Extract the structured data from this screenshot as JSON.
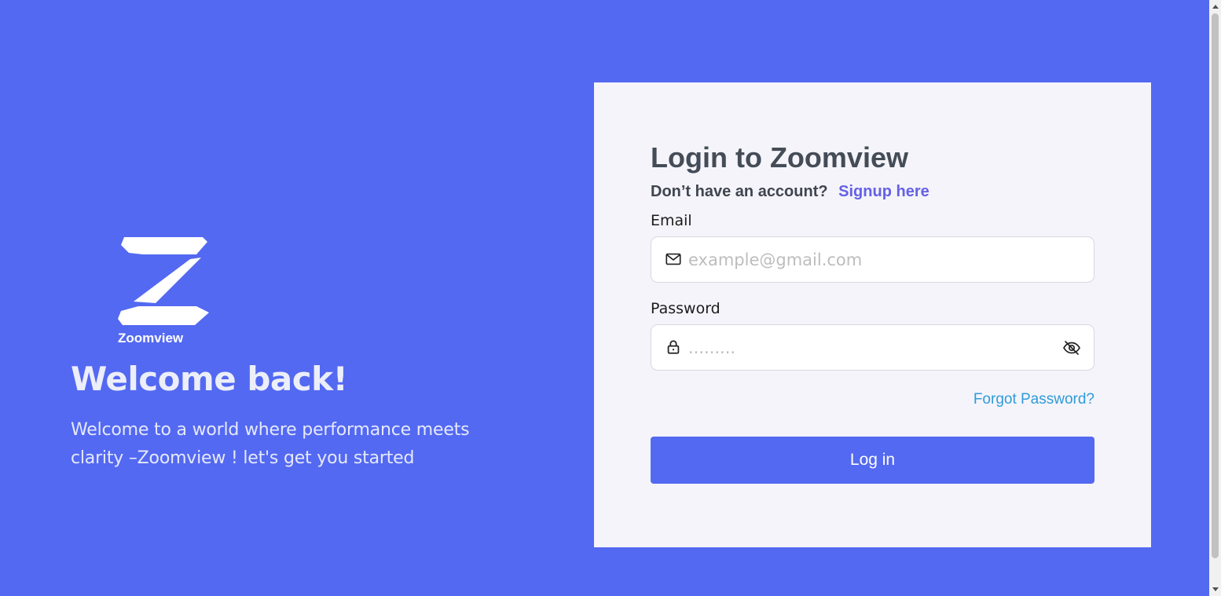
{
  "brand": {
    "name": "Zoomview",
    "logo_icon": "zoomview-z-logo"
  },
  "hero": {
    "title": "Welcome back!",
    "subtitle": "Welcome to a world where performance meets clarity –Zoomview ! let's get you started"
  },
  "login": {
    "title": "Login to Zoomview",
    "no_account_text": "Don’t have an account?",
    "signup_link": "Signup here",
    "email": {
      "label": "Email",
      "placeholder": "example@gmail.com",
      "value": "",
      "icon": "mail-icon"
    },
    "password": {
      "label": "Password",
      "placeholder": ".........",
      "value": "",
      "icon": "lock-icon",
      "toggle_icon": "eye-off-icon"
    },
    "forgot_link": "Forgot Password?",
    "submit_label": "Log in"
  },
  "colors": {
    "background": "#5369f2",
    "card": "#f5f4fa",
    "title": "#444c57",
    "signup_link": "#6461e6",
    "forgot_link": "#2f9bd9",
    "button": "#5369f2"
  }
}
